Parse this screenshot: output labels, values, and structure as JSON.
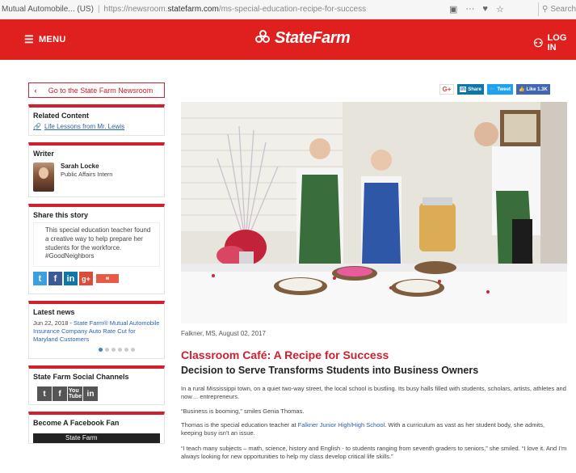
{
  "browser": {
    "site_name": "Mutual Automobile... (US)",
    "url_prefix": "https://newsroom.",
    "url_domain": "statefarm.com",
    "url_path": "/ms-special-education-recipe-for-success",
    "search_placeholder": "Search"
  },
  "header": {
    "menu_label": "MENU",
    "logo_text": "StateFarm",
    "login_label": "LOG IN",
    "color": "#e0201f"
  },
  "sidebar": {
    "newsroom_link": "Go to the State Farm Newsroom",
    "related": {
      "title": "Related Content",
      "link": "Life Lessons from Mr. Lewis"
    },
    "writer": {
      "title": "Writer",
      "name": "Sarah Locke",
      "role": "Public Affairs Intern"
    },
    "share": {
      "title": "Share this story",
      "text": "This special education teacher found a creative way to help prepare her students for the workforce. #GoodNeighbors"
    },
    "latest": {
      "title": "Latest news",
      "date": "Jun 22, 2018 -",
      "link": "State Farm® Mutual Automobile Insurance Company Auto Rate Cut for Maryland Customers"
    },
    "social": {
      "title": "State Farm Social Channels"
    },
    "facebook": {
      "title": "Become A Facebook Fan",
      "banner": "State Farm"
    }
  },
  "share_bar": {
    "gplus": "G+",
    "linkedin": "Share",
    "tweet": "Tweet",
    "like": "Like 1.3K"
  },
  "article": {
    "dateline": "Falkner, MS, August 02, 2017",
    "headline": "Classroom Café: A Recipe for Success",
    "subhead": "Decision to Serve Transforms Students into Business Owners",
    "p1": "In a rural Mississippi town, on a quiet two-way street, the local school is bustling. Its busy halls filled with students, scholars, artists, athletes and now… entrepreneurs.",
    "p2": "“Business is booming,” smiles Genia Thomas.",
    "p3_before": "Thomas is the special education teacher at ",
    "p3_link": "Falkner Junior High/High School",
    "p3_after": ". With a curriculum as vast as her student body, she admits, keeping busy isn’t an issue.",
    "p4": "“I teach many subjects – math, science, history and English - to students ranging from seventh graders to seniors,” she smiled. “I love it. And I’m always looking for new opportunities to help my class develop critical life skills.”"
  }
}
